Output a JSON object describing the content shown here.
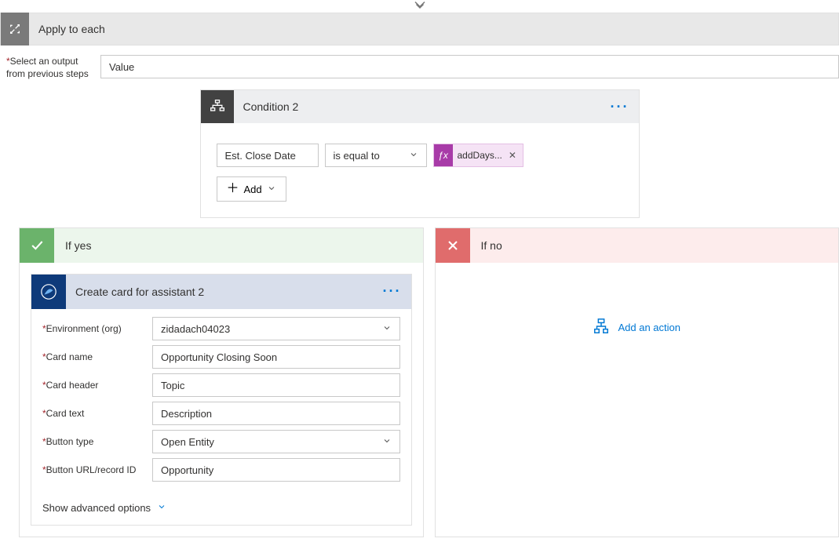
{
  "applyEach": {
    "title": "Apply to each",
    "outputLabelLine1": "Select an output",
    "outputLabelLine2": "from previous steps",
    "outputValue": "Value"
  },
  "condition": {
    "title": "Condition 2",
    "leftOperand": "Est. Close Date",
    "operator": "is equal to",
    "fxLabel": "addDays...",
    "addLabel": "Add"
  },
  "yesBranch": {
    "title": "If yes",
    "action": {
      "title": "Create card for assistant 2",
      "fields": {
        "envLabel": "Environment (org)",
        "envValue": "zidadach04023",
        "cardNameLabel": "Card name",
        "cardNameValue": "Opportunity Closing Soon",
        "cardHeaderLabel": "Card header",
        "cardHeaderValue": "Topic",
        "cardTextLabel": "Card text",
        "cardTextValue": "Description",
        "buttonTypeLabel": "Button type",
        "buttonTypeValue": "Open Entity",
        "buttonUrlLabel": "Button URL/record ID",
        "buttonUrlValue": "Opportunity"
      },
      "showAdvanced": "Show advanced options"
    }
  },
  "noBranch": {
    "title": "If no",
    "addActionLabel": "Add an action"
  }
}
